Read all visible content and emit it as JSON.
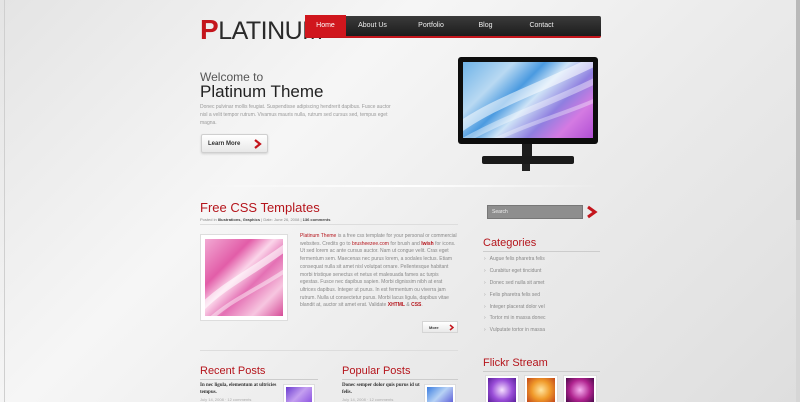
{
  "header": {
    "logo_first": "P",
    "logo_rest": "LATINUM",
    "nav": [
      "Home",
      "About Us",
      "Portfolio",
      "Blog",
      "Contact"
    ]
  },
  "hero": {
    "subtitle": "Welcome to",
    "title": "Platinum Theme",
    "text": "Donec pulvinar mollis feugiat. Suspendisse adipiscing hendrerit dapibus. Fusce auctor nisl a velit tempor rutrum. Vivamus mauris nulla, rutrum sed cursus sed, tempus eget magna.",
    "button": "Learn More"
  },
  "post": {
    "title": "Free CSS Templates",
    "meta_prefix": "Posted in",
    "meta_categories": "Illustrations, Graphics",
    "meta_date": "| Date: June 26, 2008 |",
    "meta_comments": "136 comments",
    "text_link": "Platinum Theme",
    "text_1": " is a free css template for your personal or commercial websites. Credits go to ",
    "text_credit": "brusheezee.com",
    "text_2": " for brush and ",
    "text_credit2": "Iwish",
    "text_3": " for icons. Ut sed lorem ac ante cursus auctor. Nam ut congue velit. Cras eget fermentum sem. Maecenas nec purus lorem, a sodales lectus. Etiam consequat nulla sit amet nisl volutpat ornare. Pellentesque habitant morbi tristique senectus et netus et malesuada fames ac turpis egestas. Fusce nec dapibus sapien. Morbi dignissim nibh at erat ultrices dapibus. Integer ut purus. In est fermentum ou viverra jam rutrum. Nulla ut consectetur purus. Morbi lacus ligula, dapibus vitae blandit at, auctor sit amet erat. Validate ",
    "text_xhtml": "XHTML",
    "text_and": " & ",
    "text_css": "CSS",
    "text_end": ".",
    "more": "More"
  },
  "recent": {
    "title": "Recent Posts",
    "item_title": "In nec ligula, elementum at ultricies tempus.",
    "item_meta": "July 14, 2008 · 12 comments"
  },
  "popular": {
    "title": "Popular Posts",
    "item_title": "Donec semper dolor quis purus id ut felis.",
    "item_meta": "July 14, 2008 · 12 comments"
  },
  "sidebar": {
    "search_placeholder": "Search",
    "categories_title": "Categories",
    "categories": [
      "Augue felis pharetra felis",
      "Curabitur eget tincidunt",
      "Donec sed nulla sit amet",
      "Felis pharetra felis sed",
      "Integer placerat dolor vel",
      "Tortor mi in massa donec",
      "Vulputate tortor in massa"
    ],
    "flickr_title": "Flickr Stream"
  },
  "colors": {
    "accent": "#c4151c",
    "nav_bg": "#2a2a2a"
  }
}
